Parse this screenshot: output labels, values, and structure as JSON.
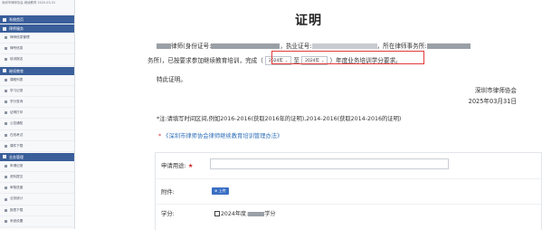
{
  "sidebar": {
    "top_text": "深圳市律师协会 继续教育 2025-03-31",
    "sections": [
      {
        "label": "系统首页"
      },
      {
        "label": "律师服务"
      },
      {
        "label": "继续教育"
      },
      {
        "label": "业务管理"
      }
    ],
    "items_a": [
      "律师信息管理",
      "律所信息",
      "培训报名"
    ],
    "items_b": [
      "课程列表",
      "学习记录",
      "学分查询",
      "证明打印",
      "公告通知",
      "在线考试",
      "课件下载"
    ],
    "items_c": [
      "申请记录",
      "资料提交",
      "审核进度",
      "业务统计",
      "报表下载",
      "系统设置"
    ]
  },
  "doc": {
    "title": "证明",
    "p1_a": "律师(身份证号:",
    "p1_b": "，执业证号:",
    "p1_c": "，所在律师事务所:",
    "p2_a": "务所)，已按要求参加继续教育培训，完成（",
    "p2_to": "至",
    "p2_b": "）年度业务培训学分要求。",
    "from_year": "2024年",
    "to_year": "2024年",
    "closing": "特此证明。",
    "org": "深圳市律师协会",
    "date": "2025年03月31日",
    "note": "*注:请填写时间区间,例如2016-2016(获取2016年的证明),2014-2016(获取2014-2016的证明)",
    "link": "《深圳市律师协会律师继续教育培训管理办法》"
  },
  "form": {
    "purpose_label": "申请用途:",
    "attachment_label": "附件:",
    "upload_label": "⊕ 上传",
    "credit_label": "学分:",
    "credit_value_a": "2024年度:",
    "credit_value_b": "学分"
  },
  "colors": {
    "accent": "#3a5f9a",
    "required": "#d32f2f",
    "link": "#2f6fb8"
  }
}
